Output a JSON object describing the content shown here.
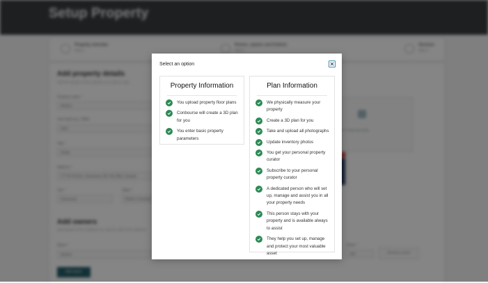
{
  "background": {
    "page_title": "Setup Property",
    "steps": [
      {
        "label": "Property overview",
        "sub": "Step 1"
      },
      {
        "label": "Rooms, spaces and Exterior",
        "sub": "Step 2"
      },
      {
        "label": "Services",
        "sub": "Step 3"
      }
    ],
    "add_property_details": {
      "title": "Add property details",
      "subtitle": "Add the details of the property you want to add"
    },
    "fields": [
      {
        "label": "Property name *",
        "value": "Modern"
      },
      {
        "label": "Year built (e.g. 1994)",
        "value": "2021"
      },
      {
        "label": "Title *",
        "value": "Strata"
      },
      {
        "label": "Address *",
        "value": "777 W 7th Ave, Vancouver, BC V5x 0B4, Canada"
      },
      {
        "label": "City *",
        "value": "Vancouver"
      },
      {
        "label": "State *",
        "value": "British Columbia"
      }
    ],
    "upload_text": "Upload or drag and drop",
    "add_owners": {
      "title": "Add owners",
      "subtitle": "Add details of the property you want to add to the platform"
    },
    "owner_name": {
      "label": "Name *",
      "value": "Modern"
    },
    "share": {
      "label": "Share *",
      "value": "100"
    },
    "add_owner_button": "Add owner",
    "remove_owner_button": "Remove owner"
  },
  "modal": {
    "title": "Select an option",
    "close_icon": "close-icon",
    "accent_color": "#2c8a55",
    "options": [
      {
        "title": "Property Information",
        "items": [
          "You upload property floor plans",
          "Conbourse will create a 3D plan for you",
          "You enter basic property parameters"
        ]
      },
      {
        "title": "Plan Information",
        "items": [
          "We physically measure your property",
          "Create a 3D plan for you",
          "Take and upload all photographs",
          "Update inventory photos",
          "You get your personal property curator",
          "Subscribe to your personal property curator",
          "A dedicated person who will set up, manage and assist you in all your property needs",
          "This person stays with your property and is available always to assist",
          "They help you set up, manage and protect your most valuable asset"
        ]
      }
    ]
  }
}
